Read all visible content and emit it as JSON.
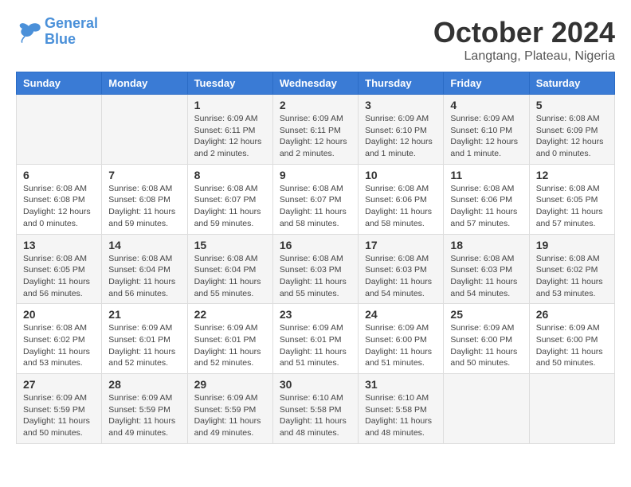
{
  "header": {
    "logo_line1": "General",
    "logo_line2": "Blue",
    "month_title": "October 2024",
    "location": "Langtang, Plateau, Nigeria"
  },
  "weekdays": [
    "Sunday",
    "Monday",
    "Tuesday",
    "Wednesday",
    "Thursday",
    "Friday",
    "Saturday"
  ],
  "weeks": [
    [
      {
        "day": "",
        "detail": ""
      },
      {
        "day": "",
        "detail": ""
      },
      {
        "day": "1",
        "detail": "Sunrise: 6:09 AM\nSunset: 6:11 PM\nDaylight: 12 hours\nand 2 minutes."
      },
      {
        "day": "2",
        "detail": "Sunrise: 6:09 AM\nSunset: 6:11 PM\nDaylight: 12 hours\nand 2 minutes."
      },
      {
        "day": "3",
        "detail": "Sunrise: 6:09 AM\nSunset: 6:10 PM\nDaylight: 12 hours\nand 1 minute."
      },
      {
        "day": "4",
        "detail": "Sunrise: 6:09 AM\nSunset: 6:10 PM\nDaylight: 12 hours\nand 1 minute."
      },
      {
        "day": "5",
        "detail": "Sunrise: 6:08 AM\nSunset: 6:09 PM\nDaylight: 12 hours\nand 0 minutes."
      }
    ],
    [
      {
        "day": "6",
        "detail": "Sunrise: 6:08 AM\nSunset: 6:08 PM\nDaylight: 12 hours\nand 0 minutes."
      },
      {
        "day": "7",
        "detail": "Sunrise: 6:08 AM\nSunset: 6:08 PM\nDaylight: 11 hours\nand 59 minutes."
      },
      {
        "day": "8",
        "detail": "Sunrise: 6:08 AM\nSunset: 6:07 PM\nDaylight: 11 hours\nand 59 minutes."
      },
      {
        "day": "9",
        "detail": "Sunrise: 6:08 AM\nSunset: 6:07 PM\nDaylight: 11 hours\nand 58 minutes."
      },
      {
        "day": "10",
        "detail": "Sunrise: 6:08 AM\nSunset: 6:06 PM\nDaylight: 11 hours\nand 58 minutes."
      },
      {
        "day": "11",
        "detail": "Sunrise: 6:08 AM\nSunset: 6:06 PM\nDaylight: 11 hours\nand 57 minutes."
      },
      {
        "day": "12",
        "detail": "Sunrise: 6:08 AM\nSunset: 6:05 PM\nDaylight: 11 hours\nand 57 minutes."
      }
    ],
    [
      {
        "day": "13",
        "detail": "Sunrise: 6:08 AM\nSunset: 6:05 PM\nDaylight: 11 hours\nand 56 minutes."
      },
      {
        "day": "14",
        "detail": "Sunrise: 6:08 AM\nSunset: 6:04 PM\nDaylight: 11 hours\nand 56 minutes."
      },
      {
        "day": "15",
        "detail": "Sunrise: 6:08 AM\nSunset: 6:04 PM\nDaylight: 11 hours\nand 55 minutes."
      },
      {
        "day": "16",
        "detail": "Sunrise: 6:08 AM\nSunset: 6:03 PM\nDaylight: 11 hours\nand 55 minutes."
      },
      {
        "day": "17",
        "detail": "Sunrise: 6:08 AM\nSunset: 6:03 PM\nDaylight: 11 hours\nand 54 minutes."
      },
      {
        "day": "18",
        "detail": "Sunrise: 6:08 AM\nSunset: 6:03 PM\nDaylight: 11 hours\nand 54 minutes."
      },
      {
        "day": "19",
        "detail": "Sunrise: 6:08 AM\nSunset: 6:02 PM\nDaylight: 11 hours\nand 53 minutes."
      }
    ],
    [
      {
        "day": "20",
        "detail": "Sunrise: 6:08 AM\nSunset: 6:02 PM\nDaylight: 11 hours\nand 53 minutes."
      },
      {
        "day": "21",
        "detail": "Sunrise: 6:09 AM\nSunset: 6:01 PM\nDaylight: 11 hours\nand 52 minutes."
      },
      {
        "day": "22",
        "detail": "Sunrise: 6:09 AM\nSunset: 6:01 PM\nDaylight: 11 hours\nand 52 minutes."
      },
      {
        "day": "23",
        "detail": "Sunrise: 6:09 AM\nSunset: 6:01 PM\nDaylight: 11 hours\nand 51 minutes."
      },
      {
        "day": "24",
        "detail": "Sunrise: 6:09 AM\nSunset: 6:00 PM\nDaylight: 11 hours\nand 51 minutes."
      },
      {
        "day": "25",
        "detail": "Sunrise: 6:09 AM\nSunset: 6:00 PM\nDaylight: 11 hours\nand 50 minutes."
      },
      {
        "day": "26",
        "detail": "Sunrise: 6:09 AM\nSunset: 6:00 PM\nDaylight: 11 hours\nand 50 minutes."
      }
    ],
    [
      {
        "day": "27",
        "detail": "Sunrise: 6:09 AM\nSunset: 5:59 PM\nDaylight: 11 hours\nand 50 minutes."
      },
      {
        "day": "28",
        "detail": "Sunrise: 6:09 AM\nSunset: 5:59 PM\nDaylight: 11 hours\nand 49 minutes."
      },
      {
        "day": "29",
        "detail": "Sunrise: 6:09 AM\nSunset: 5:59 PM\nDaylight: 11 hours\nand 49 minutes."
      },
      {
        "day": "30",
        "detail": "Sunrise: 6:10 AM\nSunset: 5:58 PM\nDaylight: 11 hours\nand 48 minutes."
      },
      {
        "day": "31",
        "detail": "Sunrise: 6:10 AM\nSunset: 5:58 PM\nDaylight: 11 hours\nand 48 minutes."
      },
      {
        "day": "",
        "detail": ""
      },
      {
        "day": "",
        "detail": ""
      }
    ]
  ]
}
